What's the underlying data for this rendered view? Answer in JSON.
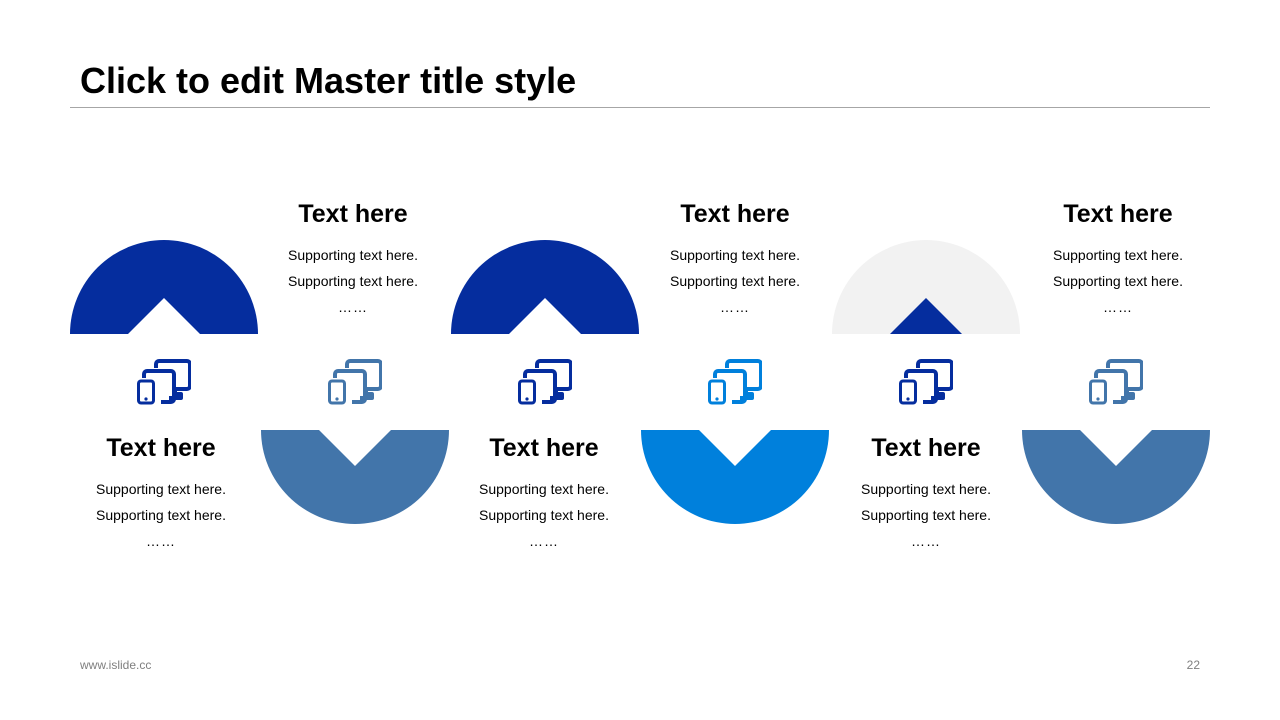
{
  "slide": {
    "title": "Click to edit Master title style",
    "footer_url": "www.islide.cc",
    "page_number": "22"
  },
  "columns": [
    {
      "orientation": "top",
      "fill": "#052D9E",
      "notch": "#FFFFFF",
      "icon_color": "#052D9E",
      "heading": "Text here",
      "line1": "Supporting text here.",
      "line2": "Supporting text here.",
      "dots": "……",
      "icon": "devices-icon"
    },
    {
      "orientation": "bottom",
      "fill": "#4275AA",
      "notch": "#FFFFFF",
      "icon_color": "#4275AA",
      "heading": "Text here",
      "line1": "Supporting text here.",
      "line2": "Supporting text here.",
      "dots": "……",
      "icon": "devices-icon"
    },
    {
      "orientation": "top",
      "fill": "#052D9E",
      "notch": "#FFFFFF",
      "icon_color": "#052D9E",
      "heading": "Text here",
      "line1": "Supporting text here.",
      "line2": "Supporting text here.",
      "dots": "……",
      "icon": "devices-icon"
    },
    {
      "orientation": "bottom",
      "fill": "#0080DC",
      "notch": "#FFFFFF",
      "icon_color": "#0080DC",
      "heading": "Text here",
      "line1": "Supporting text here.",
      "line2": "Supporting text here.",
      "dots": "……",
      "icon": "devices-icon"
    },
    {
      "orientation": "top",
      "fill": "#F2F2F2",
      "notch": "#052D9E",
      "icon_color": "#052D9E",
      "heading": "Text here",
      "line1": "Supporting text here.",
      "line2": "Supporting text here.",
      "dots": "……",
      "icon": "devices-icon"
    },
    {
      "orientation": "bottom",
      "fill": "#4275AA",
      "notch": "#FFFFFF",
      "icon_color": "#4275AA",
      "heading": "Text here",
      "line1": "Supporting text here.",
      "line2": "Supporting text here.",
      "dots": "……",
      "icon": "devices-icon"
    }
  ]
}
